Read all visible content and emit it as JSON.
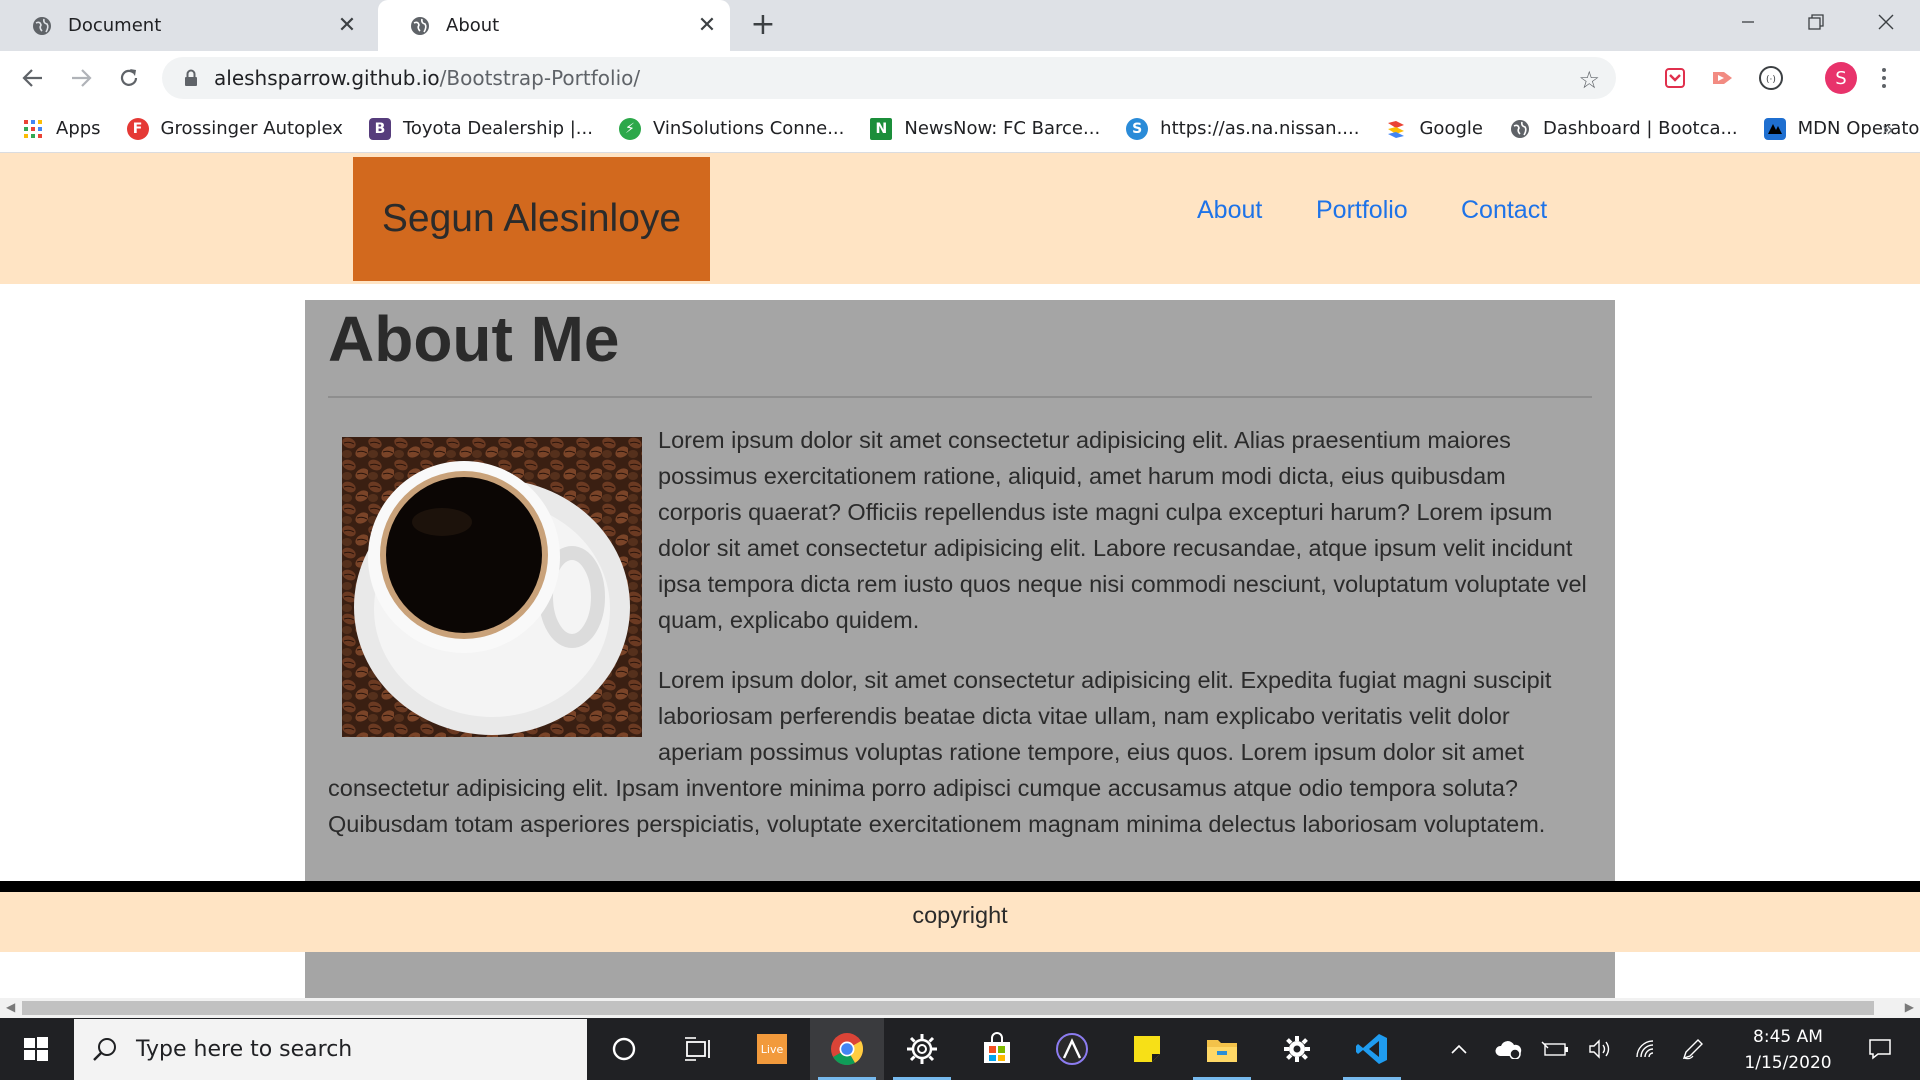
{
  "browser": {
    "tabs": [
      {
        "title": "Document",
        "active": false
      },
      {
        "title": "About",
        "active": true
      }
    ],
    "address": {
      "host": "aleshsparrow.github.io",
      "path": "/Bootstrap-Portfolio/"
    },
    "profile_initial": "S",
    "bookmarks": [
      {
        "label": "Apps",
        "icon": "apps-grid-icon",
        "color": "#4285f4"
      },
      {
        "label": "Grossinger Autoplex",
        "icon": "f-logo-icon",
        "color": "#e53935"
      },
      {
        "label": "Toyota Dealership |...",
        "icon": "bootstrap-b-icon",
        "color": "#563d7c"
      },
      {
        "label": "VinSolutions Conne...",
        "icon": "bolt-icon",
        "color": "#2ca84a"
      },
      {
        "label": "NewsNow: FC Barce...",
        "icon": "newsnow-icon",
        "color": "#1b8e3a"
      },
      {
        "label": "https://as.na.nissan....",
        "icon": "nissan-s-icon",
        "color": "#2a8bd8"
      },
      {
        "label": "Google",
        "icon": "google-icon",
        "color": "#ea4335"
      },
      {
        "label": "Dashboard | Bootca...",
        "icon": "globe-icon",
        "color": "#5f6368"
      },
      {
        "label": "MDN Operators",
        "icon": "mdn-icon",
        "color": "#1f6fd0"
      }
    ],
    "bookmarks_more": "»"
  },
  "site": {
    "brand": "Segun Alesinloye",
    "nav": [
      "About",
      "Portfolio",
      "Contact"
    ],
    "about": {
      "title": "About Me",
      "paragraphs": [
        "Lorem ipsum dolor sit amet consectetur adipisicing elit. Alias praesentium maiores possimus exercitationem ratione, aliquid, amet harum modi dicta, eius quibusdam corporis quaerat? Officiis repellendus iste magni culpa excepturi harum? Lorem ipsum dolor sit amet consectetur adipisicing elit. Labore recusandae, atque ipsum velit incidunt ipsa tempora dicta rem iusto quos neque nisi commodi nesciunt, voluptatum voluptate vel quam, explicabo quidem.",
        "Lorem ipsum dolor, sit amet consectetur adipisicing elit. Expedita fugiat magni suscipit laboriosam perferendis beatae dicta vitae ullam, nam explicabo veritatis velit dolor aperiam possimus voluptas ratione tempore, eius quos. Lorem ipsum dolor sit amet consectetur adipisicing elit. Ipsam inventore minima porro adipisci cumque accusamus atque odio tempora soluta? Quibusdam totam asperiores perspiciatis, voluptate exercitationem magnam minima delectus laboriosam voluptatem."
      ]
    },
    "footer": "copyright",
    "colors": {
      "nav_bg": "#ffe4c4",
      "brand_bg": "#d2691e",
      "link": "#1e73e8",
      "about_bg": "#a5a5a5"
    }
  },
  "taskbar": {
    "search_placeholder": "Type here to search",
    "time": "8:45 AM",
    "date": "1/15/2020",
    "live_label": "Live"
  }
}
